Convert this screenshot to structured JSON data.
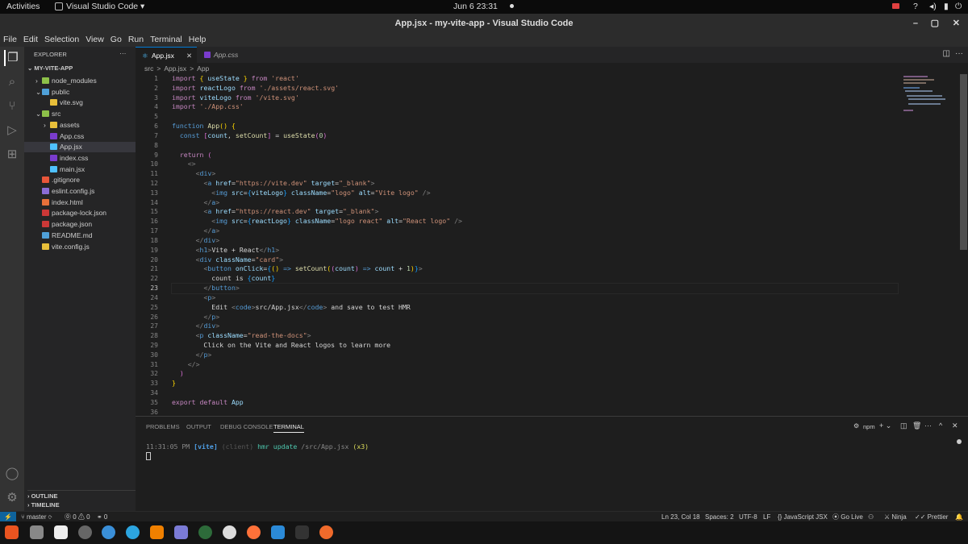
{
  "gnome": {
    "activities": "Activities",
    "app": "Visual Studio Code ▾",
    "datetime": "Jun 6  23:31"
  },
  "window_title": "App.jsx - my-vite-app - Visual Studio Code",
  "menu": [
    "File",
    "Edit",
    "Selection",
    "View",
    "Go",
    "Run",
    "Terminal",
    "Help"
  ],
  "sidebar": {
    "header": "EXPLORER",
    "more": "···",
    "root": "MY-VITE-APP",
    "items": [
      {
        "label": "node_modules",
        "indent": 1,
        "arrow": "›",
        "icon": "folder",
        "color": "#8dc149"
      },
      {
        "label": "public",
        "indent": 1,
        "arrow": "⌄",
        "icon": "folder",
        "color": "#4fa0d8"
      },
      {
        "label": "vite.svg",
        "indent": 2,
        "arrow": "",
        "icon": "vite",
        "color": "#e8bf3a"
      },
      {
        "label": "src",
        "indent": 1,
        "arrow": "⌄",
        "icon": "folder",
        "color": "#8dc149"
      },
      {
        "label": "assets",
        "indent": 2,
        "arrow": "›",
        "icon": "folder",
        "color": "#e8bf3a"
      },
      {
        "label": "App.css",
        "indent": 2,
        "arrow": "",
        "icon": "css",
        "color": "#7a3ccd"
      },
      {
        "label": "App.jsx",
        "indent": 2,
        "arrow": "",
        "icon": "react",
        "color": "#4fc1ff",
        "selected": true
      },
      {
        "label": "index.css",
        "indent": 2,
        "arrow": "",
        "icon": "css",
        "color": "#7a3ccd"
      },
      {
        "label": "main.jsx",
        "indent": 2,
        "arrow": "",
        "icon": "react",
        "color": "#4fc1ff"
      },
      {
        "label": ".gitignore",
        "indent": 1,
        "arrow": "",
        "icon": "git",
        "color": "#e8563a"
      },
      {
        "label": "eslint.config.js",
        "indent": 1,
        "arrow": "",
        "icon": "eslint",
        "color": "#8a6cd6"
      },
      {
        "label": "index.html",
        "indent": 1,
        "arrow": "",
        "icon": "html",
        "color": "#e8703a"
      },
      {
        "label": "package-lock.json",
        "indent": 1,
        "arrow": "",
        "icon": "npm",
        "color": "#cb3837"
      },
      {
        "label": "package.json",
        "indent": 1,
        "arrow": "",
        "icon": "npm",
        "color": "#cb3837"
      },
      {
        "label": "README.md",
        "indent": 1,
        "arrow": "",
        "icon": "info",
        "color": "#4fa0d8"
      },
      {
        "label": "vite.config.js",
        "indent": 1,
        "arrow": "",
        "icon": "vite",
        "color": "#e8bf3a"
      }
    ],
    "outline": "OUTLINE",
    "timeline": "TIMELINE"
  },
  "tabs": [
    {
      "label": "App.jsx",
      "active": true
    },
    {
      "label": "App.css",
      "active": false
    }
  ],
  "breadcrumb": [
    "src",
    ">",
    "App.jsx",
    ">",
    "App"
  ],
  "code_lines": [
    [
      [
        "kw",
        "import "
      ],
      [
        "br",
        "{ "
      ],
      [
        "var",
        "useState"
      ],
      [
        "br",
        " }"
      ],
      [
        "kw",
        " from "
      ],
      [
        "str",
        "'react'"
      ]
    ],
    [
      [
        "kw",
        "import "
      ],
      [
        "var",
        "reactLogo"
      ],
      [
        "kw",
        " from "
      ],
      [
        "str",
        "'./assets/react.svg'"
      ]
    ],
    [
      [
        "kw",
        "import "
      ],
      [
        "var",
        "viteLogo"
      ],
      [
        "kw",
        " from "
      ],
      [
        "str",
        "'/vite.svg'"
      ]
    ],
    [
      [
        "kw",
        "import "
      ],
      [
        "str",
        "'./App.css'"
      ]
    ],
    [],
    [
      [
        "kb",
        "function "
      ],
      [
        "fn",
        "App"
      ],
      [
        "br",
        "() {"
      ]
    ],
    [
      [
        "txt",
        "  "
      ],
      [
        "kb",
        "const "
      ],
      [
        "br2",
        "["
      ],
      [
        "var",
        "count"
      ],
      [
        "txt",
        ", "
      ],
      [
        "fn",
        "setCount"
      ],
      [
        "br2",
        "]"
      ],
      [
        "txt",
        " = "
      ],
      [
        "fn",
        "useState"
      ],
      [
        "br2",
        "("
      ],
      [
        "num",
        "0"
      ],
      [
        "br2",
        ")"
      ]
    ],
    [],
    [
      [
        "txt",
        "  "
      ],
      [
        "kw",
        "return "
      ],
      [
        "br2",
        "("
      ]
    ],
    [
      [
        "txt",
        "    "
      ],
      [
        "gray",
        "<>"
      ]
    ],
    [
      [
        "txt",
        "      "
      ],
      [
        "gray",
        "<"
      ],
      [
        "tag",
        "div"
      ],
      [
        "gray",
        ">"
      ]
    ],
    [
      [
        "txt",
        "        "
      ],
      [
        "gray",
        "<"
      ],
      [
        "tag",
        "a "
      ],
      [
        "attr",
        "href"
      ],
      [
        "txt",
        "="
      ],
      [
        "str",
        "\"https://vite.dev\" "
      ],
      [
        "attr",
        "target"
      ],
      [
        "txt",
        "="
      ],
      [
        "str",
        "\"_blank\""
      ],
      [
        "gray",
        ">"
      ]
    ],
    [
      [
        "txt",
        "          "
      ],
      [
        "gray",
        "<"
      ],
      [
        "tag",
        "img "
      ],
      [
        "attr",
        "src"
      ],
      [
        "txt",
        "="
      ],
      [
        "br3",
        "{"
      ],
      [
        "var",
        "viteLogo"
      ],
      [
        "br3",
        "}"
      ],
      [
        "attr",
        " className"
      ],
      [
        "txt",
        "="
      ],
      [
        "str",
        "\"logo\" "
      ],
      [
        "attr",
        "alt"
      ],
      [
        "txt",
        "="
      ],
      [
        "str",
        "\"Vite logo\""
      ],
      [
        "gray",
        " />"
      ]
    ],
    [
      [
        "txt",
        "        "
      ],
      [
        "gray",
        "</"
      ],
      [
        "tag",
        "a"
      ],
      [
        "gray",
        ">"
      ]
    ],
    [
      [
        "txt",
        "        "
      ],
      [
        "gray",
        "<"
      ],
      [
        "tag",
        "a "
      ],
      [
        "attr",
        "href"
      ],
      [
        "txt",
        "="
      ],
      [
        "str",
        "\"https://react.dev\" "
      ],
      [
        "attr",
        "target"
      ],
      [
        "txt",
        "="
      ],
      [
        "str",
        "\"_blank\""
      ],
      [
        "gray",
        ">"
      ]
    ],
    [
      [
        "txt",
        "          "
      ],
      [
        "gray",
        "<"
      ],
      [
        "tag",
        "img "
      ],
      [
        "attr",
        "src"
      ],
      [
        "txt",
        "="
      ],
      [
        "br3",
        "{"
      ],
      [
        "var",
        "reactLogo"
      ],
      [
        "br3",
        "}"
      ],
      [
        "attr",
        " className"
      ],
      [
        "txt",
        "="
      ],
      [
        "str",
        "\"logo react\" "
      ],
      [
        "attr",
        "alt"
      ],
      [
        "txt",
        "="
      ],
      [
        "str",
        "\"React logo\""
      ],
      [
        "gray",
        " />"
      ]
    ],
    [
      [
        "txt",
        "        "
      ],
      [
        "gray",
        "</"
      ],
      [
        "tag",
        "a"
      ],
      [
        "gray",
        ">"
      ]
    ],
    [
      [
        "txt",
        "      "
      ],
      [
        "gray",
        "</"
      ],
      [
        "tag",
        "div"
      ],
      [
        "gray",
        ">"
      ]
    ],
    [
      [
        "txt",
        "      "
      ],
      [
        "gray",
        "<"
      ],
      [
        "tag",
        "h1"
      ],
      [
        "gray",
        ">"
      ],
      [
        "txt",
        "Vite + React"
      ],
      [
        "gray",
        "</"
      ],
      [
        "tag",
        "h1"
      ],
      [
        "gray",
        ">"
      ]
    ],
    [
      [
        "txt",
        "      "
      ],
      [
        "gray",
        "<"
      ],
      [
        "tag",
        "div "
      ],
      [
        "attr",
        "className"
      ],
      [
        "txt",
        "="
      ],
      [
        "str",
        "\"card\""
      ],
      [
        "gray",
        ">"
      ]
    ],
    [
      [
        "txt",
        "        "
      ],
      [
        "gray",
        "<"
      ],
      [
        "tag",
        "button "
      ],
      [
        "attr",
        "onClick"
      ],
      [
        "txt",
        "="
      ],
      [
        "br3",
        "{"
      ],
      [
        "br",
        "()"
      ],
      [
        "kb",
        " => "
      ],
      [
        "fn",
        "setCount"
      ],
      [
        "br",
        "("
      ],
      [
        "br2",
        "("
      ],
      [
        "var",
        "count"
      ],
      [
        "br2",
        ")"
      ],
      [
        "kb",
        " => "
      ],
      [
        "var",
        "count"
      ],
      [
        "txt",
        " + "
      ],
      [
        "num",
        "1"
      ],
      [
        "br",
        ")"
      ],
      [
        "br3",
        "}"
      ],
      [
        "gray",
        ">"
      ]
    ],
    [
      [
        "txt",
        "          count is "
      ],
      [
        "br3",
        "{"
      ],
      [
        "var",
        "count"
      ],
      [
        "br3",
        "}"
      ]
    ],
    [
      [
        "txt",
        "        "
      ],
      [
        "gray",
        "</"
      ],
      [
        "tag",
        "button"
      ],
      [
        "gray",
        ">"
      ]
    ],
    [
      [
        "txt",
        "        "
      ],
      [
        "gray",
        "<"
      ],
      [
        "tag",
        "p"
      ],
      [
        "gray",
        ">"
      ]
    ],
    [
      [
        "txt",
        "          Edit "
      ],
      [
        "gray",
        "<"
      ],
      [
        "tag",
        "code"
      ],
      [
        "gray",
        ">"
      ],
      [
        "txt",
        "src/App.jsx"
      ],
      [
        "gray",
        "</"
      ],
      [
        "tag",
        "code"
      ],
      [
        "gray",
        ">"
      ],
      [
        "txt",
        " and save to test HMR"
      ]
    ],
    [
      [
        "txt",
        "        "
      ],
      [
        "gray",
        "</"
      ],
      [
        "tag",
        "p"
      ],
      [
        "gray",
        ">"
      ]
    ],
    [
      [
        "txt",
        "      "
      ],
      [
        "gray",
        "</"
      ],
      [
        "tag",
        "div"
      ],
      [
        "gray",
        ">"
      ]
    ],
    [
      [
        "txt",
        "      "
      ],
      [
        "gray",
        "<"
      ],
      [
        "tag",
        "p "
      ],
      [
        "attr",
        "className"
      ],
      [
        "txt",
        "="
      ],
      [
        "str",
        "\"read-the-docs\""
      ],
      [
        "gray",
        ">"
      ]
    ],
    [
      [
        "txt",
        "        Click on the Vite and React logos to learn more"
      ]
    ],
    [
      [
        "txt",
        "      "
      ],
      [
        "gray",
        "</"
      ],
      [
        "tag",
        "p"
      ],
      [
        "gray",
        ">"
      ]
    ],
    [
      [
        "txt",
        "    "
      ],
      [
        "gray",
        "</>"
      ]
    ],
    [
      [
        "txt",
        "  "
      ],
      [
        "br2",
        ")"
      ]
    ],
    [
      [
        "br",
        "}"
      ]
    ],
    [],
    [
      [
        "kw",
        "export default "
      ],
      [
        "var",
        "App"
      ]
    ],
    []
  ],
  "panel": {
    "tabs": [
      "PROBLEMS",
      "OUTPUT",
      "DEBUG CONSOLE",
      "TERMINAL"
    ],
    "active": "TERMINAL",
    "shell": "npm",
    "plus": "+ ⌄",
    "terminal": [
      {
        "time": "11:31:05 PM",
        "tag": "[vite]",
        "client": "(client)",
        "msg": "hmr update",
        "path": "/src/App.jsx",
        "count": "(x3)"
      }
    ]
  },
  "status": {
    "branch": "master",
    "errors": "⓪ 0 ⚠ 0",
    "ports": "⚭ 0",
    "position": "Ln 23, Col 18",
    "spaces": "Spaces: 2",
    "encoding": "UTF-8",
    "eol": "LF",
    "language": "JavaScript JSX",
    "golive": "Go Live",
    "ninja": "Ninja",
    "prettier": "Prettier"
  }
}
